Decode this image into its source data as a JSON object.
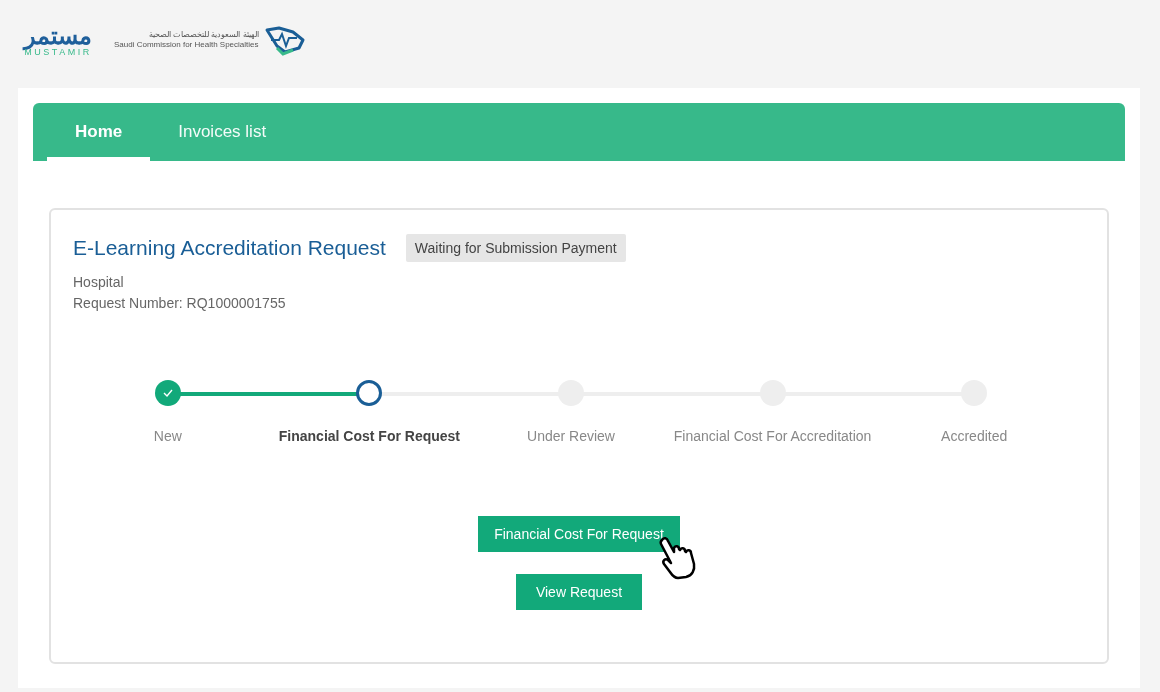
{
  "header": {
    "logo_arabic": "مستمر",
    "logo_latin": "MUSTAMIR",
    "org_arabic": "الهيئة السعودية للتخصصات الصحية",
    "org_english": "Saudi Commission for Health Specialties"
  },
  "tabs": [
    {
      "label": "Home",
      "selected": true
    },
    {
      "label": "Invoices list",
      "selected": false
    }
  ],
  "request": {
    "title": "E-Learning Accreditation Request",
    "status_badge": "Waiting for Submission Payment",
    "type": "Hospital",
    "number": "Request Number: RQ1000001755"
  },
  "steps": [
    {
      "label": "New",
      "kind": "done"
    },
    {
      "label": "Financial Cost For Request",
      "kind": "current"
    },
    {
      "label": "Under Review",
      "kind": "pending"
    },
    {
      "label": "Financial Cost For Accreditation",
      "kind": "pending"
    },
    {
      "label": "Accredited",
      "kind": "pending"
    }
  ],
  "buttons": [
    "Financial Cost For Request",
    "View Request"
  ]
}
